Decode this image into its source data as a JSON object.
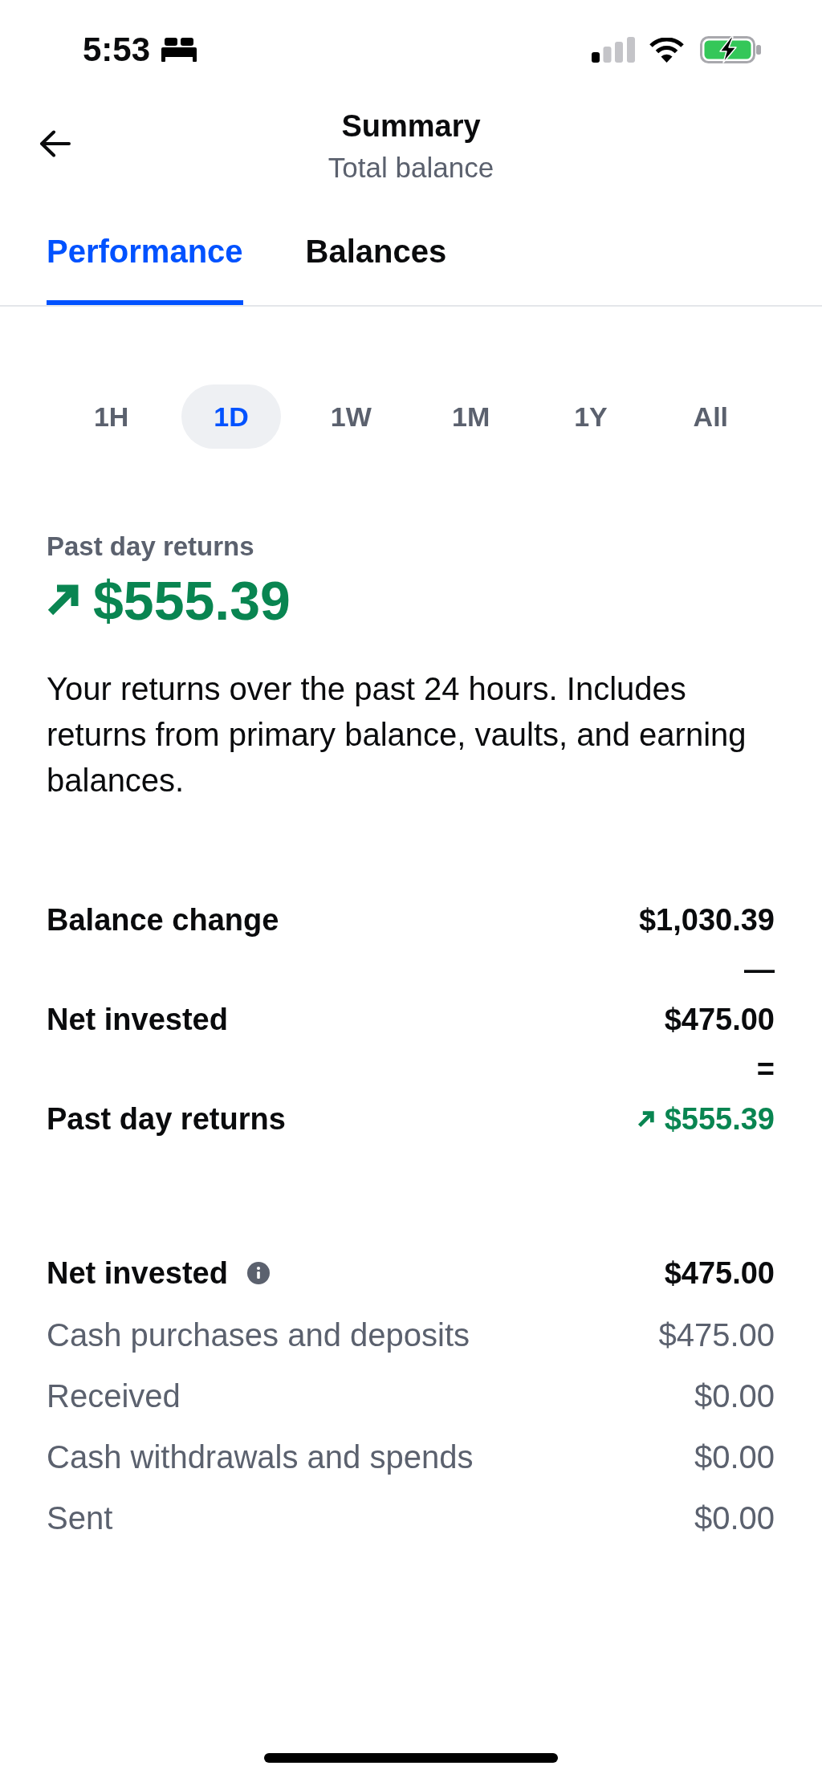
{
  "status_bar": {
    "time": "5:53"
  },
  "header": {
    "title": "Summary",
    "subtitle": "Total balance"
  },
  "tabs": [
    {
      "label": "Performance",
      "selected": true
    },
    {
      "label": "Balances",
      "selected": false
    }
  ],
  "periods": [
    {
      "label": "1H",
      "selected": false
    },
    {
      "label": "1D",
      "selected": true
    },
    {
      "label": "1W",
      "selected": false
    },
    {
      "label": "1M",
      "selected": false
    },
    {
      "label": "1Y",
      "selected": false
    },
    {
      "label": "All",
      "selected": false
    }
  ],
  "returns": {
    "label": "Past day returns",
    "amount": "$555.39",
    "positive": true,
    "description": "Your returns over the past 24 hours. Includes returns from primary balance, vaults, and earning balances."
  },
  "calculation": [
    {
      "kind": "row",
      "label": "Balance change",
      "value": "$1,030.39",
      "positive": false
    },
    {
      "kind": "operator",
      "symbol": "—"
    },
    {
      "kind": "row",
      "label": "Net invested",
      "value": "$475.00",
      "positive": false
    },
    {
      "kind": "operator",
      "symbol": "="
    },
    {
      "kind": "row",
      "label": "Past day returns",
      "value": "$555.39",
      "positive": true
    }
  ],
  "net_invested": {
    "label": "Net invested",
    "value": "$475.00",
    "items": [
      {
        "label": "Cash purchases and deposits",
        "value": "$475.00"
      },
      {
        "label": "Received",
        "value": "$0.00"
      },
      {
        "label": "Cash withdrawals and spends",
        "value": "$0.00"
      },
      {
        "label": "Sent",
        "value": "$0.00"
      }
    ]
  }
}
